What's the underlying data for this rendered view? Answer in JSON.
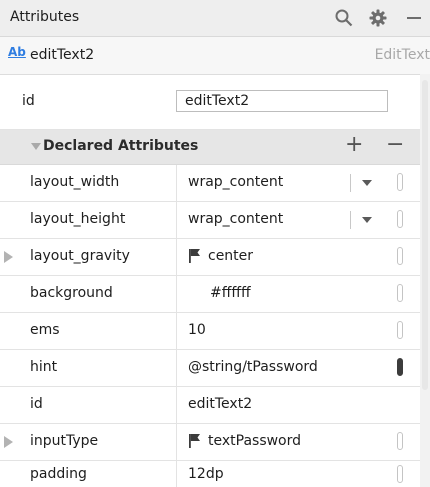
{
  "header": {
    "title": "Attributes",
    "icons": [
      "search-icon",
      "gear-icon",
      "minimize-icon"
    ]
  },
  "selection": {
    "icon_text": "Ab",
    "name": "editText2",
    "class_name": "EditText"
  },
  "id_row": {
    "label": "id",
    "value": "editText2"
  },
  "declared": {
    "title": "Declared Attributes",
    "add": "+",
    "remove": "−"
  },
  "attributes": [
    {
      "label": "layout_width",
      "value": "wrap_content"
    },
    {
      "label": "layout_height",
      "value": "wrap_content"
    },
    {
      "label": "layout_gravity",
      "value": "center"
    },
    {
      "label": "background",
      "value": "#ffffff"
    },
    {
      "label": "ems",
      "value": "10"
    },
    {
      "label": "hint",
      "value": "@string/tPassword"
    },
    {
      "label": "id",
      "value": "editText2"
    },
    {
      "label": "inputType",
      "value": "textPassword"
    },
    {
      "label": "padding",
      "value": "12dp"
    }
  ],
  "colors": {
    "accent_blue": "#2f7de1",
    "header_bg": "#eeeeee",
    "section_bg": "#e6e6e6"
  }
}
